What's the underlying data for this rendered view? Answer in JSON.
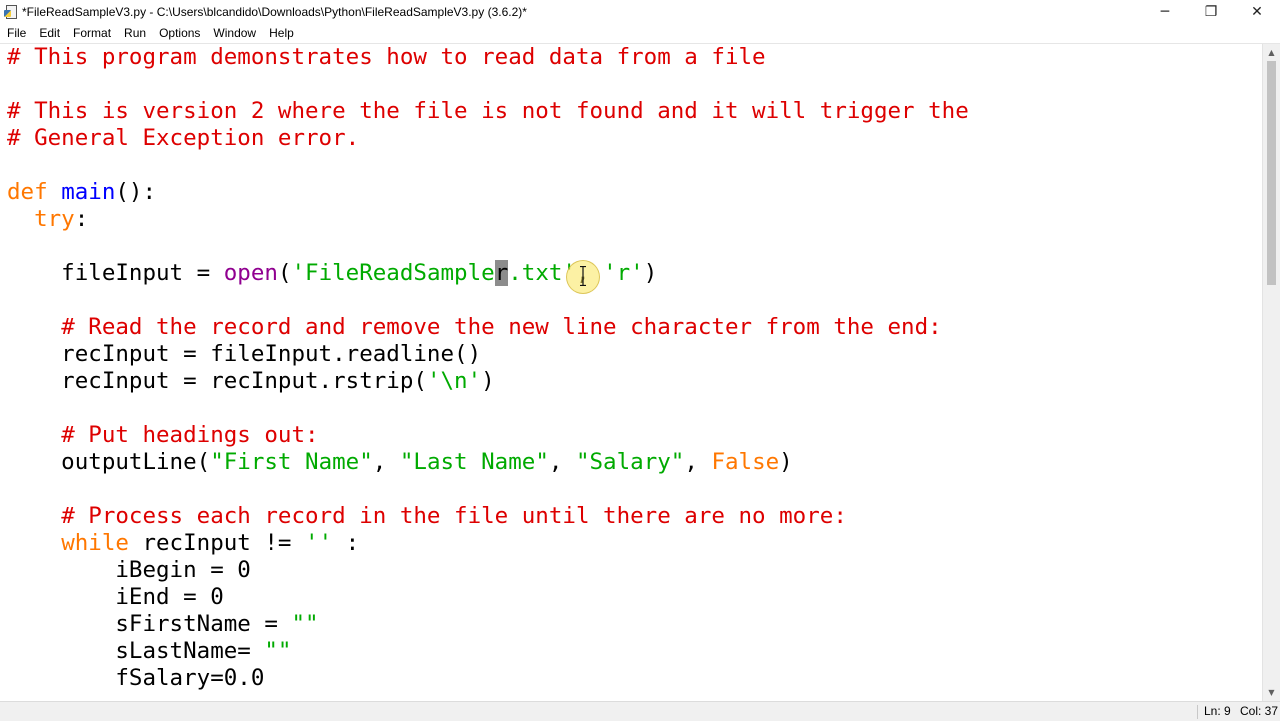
{
  "window": {
    "title": "*FileReadSampleV3.py - C:\\Users\\blcandido\\Downloads\\Python\\FileReadSampleV3.py (3.6.2)*",
    "controls": {
      "minimize": "─",
      "maximize": "❐",
      "close": "✕"
    },
    "icon": "python-file-icon"
  },
  "menu": {
    "items": [
      "File",
      "Edit",
      "Format",
      "Run",
      "Options",
      "Window",
      "Help"
    ]
  },
  "editor": {
    "selected_char": "r",
    "lines": [
      [
        {
          "t": "comment",
          "s": "# This program demonstrates how to read data from a file"
        }
      ],
      [],
      [
        {
          "t": "comment",
          "s": "# This is version 2 where the file is not found and it will trigger the"
        }
      ],
      [
        {
          "t": "comment",
          "s": "# General Exception error."
        }
      ],
      [],
      [
        {
          "t": "keyword",
          "s": "def"
        },
        {
          "t": "plain",
          "s": " "
        },
        {
          "t": "def",
          "s": "main"
        },
        {
          "t": "plain",
          "s": "():"
        }
      ],
      [
        {
          "t": "plain",
          "s": "  "
        },
        {
          "t": "keyword",
          "s": "try"
        },
        {
          "t": "plain",
          "s": ":"
        }
      ],
      [],
      [
        {
          "t": "plain",
          "s": "    fileInput = "
        },
        {
          "t": "builtin",
          "s": "open"
        },
        {
          "t": "plain",
          "s": "("
        },
        {
          "t": "string",
          "s": "'FileReadSample"
        },
        {
          "t": "sel",
          "s": "r"
        },
        {
          "t": "string",
          "s": ".txt'"
        },
        {
          "t": "plain",
          "s": ", "
        },
        {
          "t": "string",
          "s": "'r'"
        },
        {
          "t": "plain",
          "s": ")"
        }
      ],
      [],
      [
        {
          "t": "plain",
          "s": "    "
        },
        {
          "t": "comment",
          "s": "# Read the record and remove the new line character from the end:"
        }
      ],
      [
        {
          "t": "plain",
          "s": "    recInput = fileInput.readline()"
        }
      ],
      [
        {
          "t": "plain",
          "s": "    recInput = recInput.rstrip("
        },
        {
          "t": "string",
          "s": "'\\n'"
        },
        {
          "t": "plain",
          "s": ")"
        }
      ],
      [],
      [
        {
          "t": "plain",
          "s": "    "
        },
        {
          "t": "comment",
          "s": "# Put headings out:"
        }
      ],
      [
        {
          "t": "plain",
          "s": "    outputLine("
        },
        {
          "t": "string",
          "s": "\"First Name\""
        },
        {
          "t": "plain",
          "s": ", "
        },
        {
          "t": "string",
          "s": "\"Last Name\""
        },
        {
          "t": "plain",
          "s": ", "
        },
        {
          "t": "string",
          "s": "\"Salary\""
        },
        {
          "t": "plain",
          "s": ", "
        },
        {
          "t": "keyword",
          "s": "False"
        },
        {
          "t": "plain",
          "s": ")"
        }
      ],
      [],
      [
        {
          "t": "plain",
          "s": "    "
        },
        {
          "t": "comment",
          "s": "# Process each record in the file until there are no more:"
        }
      ],
      [
        {
          "t": "plain",
          "s": "    "
        },
        {
          "t": "keyword",
          "s": "while"
        },
        {
          "t": "plain",
          "s": " recInput != "
        },
        {
          "t": "string",
          "s": "''"
        },
        {
          "t": "plain",
          "s": " :"
        }
      ],
      [
        {
          "t": "plain",
          "s": "        iBegin = 0"
        }
      ],
      [
        {
          "t": "plain",
          "s": "        iEnd = 0"
        }
      ],
      [
        {
          "t": "plain",
          "s": "        sFirstName = "
        },
        {
          "t": "string",
          "s": "\"\""
        }
      ],
      [
        {
          "t": "plain",
          "s": "        sLastName= "
        },
        {
          "t": "string",
          "s": "\"\""
        }
      ],
      [
        {
          "t": "plain",
          "s": "        fSalary=0.0"
        }
      ]
    ]
  },
  "scrollbar": {
    "position_fraction": 0.0,
    "visible_fraction": 0.36
  },
  "status": {
    "line": "Ln: 9",
    "col": "Col: 37"
  }
}
